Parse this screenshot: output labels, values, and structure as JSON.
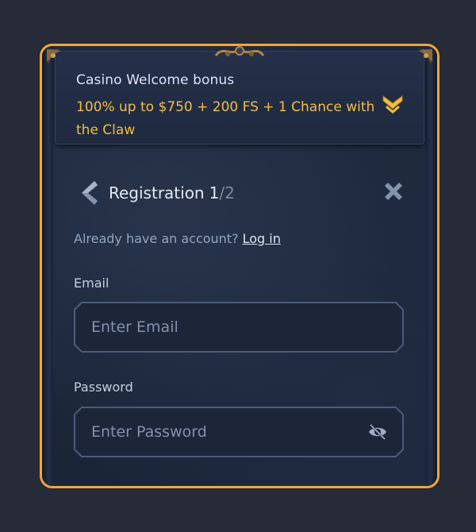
{
  "bonus": {
    "title": "Casino Welcome bonus",
    "offer": "100% up to $750 + 200 FS + 1 Chance with the Claw"
  },
  "registration": {
    "title": "Registration",
    "step": "1",
    "separator": "/",
    "total": "2"
  },
  "login_prompt": {
    "text": "Already have an account?",
    "link": "Log in"
  },
  "email": {
    "label": "Email",
    "placeholder": "Enter Email",
    "value": ""
  },
  "password": {
    "label": "Password",
    "placeholder": "Enter Password",
    "value": ""
  },
  "colors": {
    "accent_border": "#f0a83a",
    "offer_text": "#f3be3f",
    "panel_bg": "#1f2a3d",
    "page_bg": "#272a37",
    "muted_text": "#93a6c4"
  },
  "icons": {
    "back": "back-chevron-icon",
    "close": "close-icon",
    "expand": "chevron-down-icon",
    "eye": "eye-off-icon"
  }
}
